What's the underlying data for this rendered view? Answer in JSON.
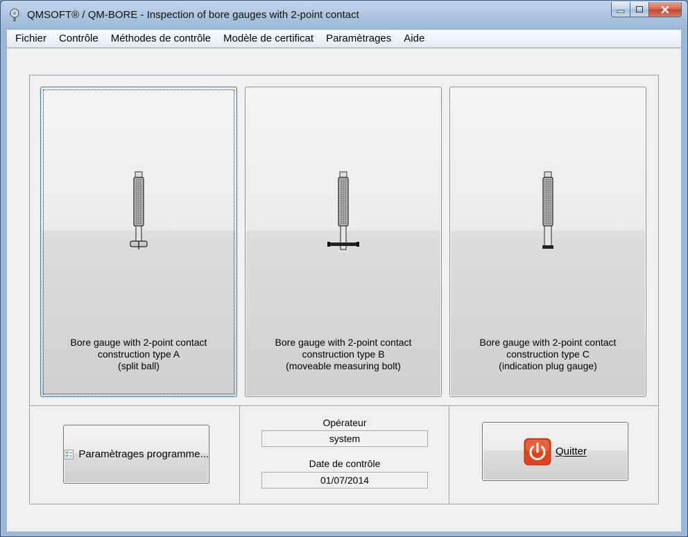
{
  "window": {
    "title": "QMSOFT® / QM-BORE - Inspection of bore gauges with 2-point contact"
  },
  "menu": [
    "Fichier",
    "Contrôle",
    "Méthodes de contrôle",
    "Modèle de certificat",
    "Paramètrages",
    "Aide"
  ],
  "cards": [
    {
      "lines": [
        "Bore gauge with 2-point contact",
        "construction type A",
        "(split ball)"
      ],
      "icon": "bore-gauge-split-ball-icon"
    },
    {
      "lines": [
        "Bore gauge with 2-point contact",
        "construction type B",
        "(moveable measuring bolt)"
      ],
      "icon": "bore-gauge-measuring-bolt-icon"
    },
    {
      "lines": [
        "Bore gauge with 2-point contact",
        "construction type C",
        "(indication plug gauge)"
      ],
      "icon": "bore-gauge-plug-icon"
    }
  ],
  "settings_button": {
    "label": "Paramètrages programme..."
  },
  "operator": {
    "label": "Opérateur",
    "value": "system"
  },
  "date": {
    "label": "Date de contrôle",
    "value": "01/07/2014"
  },
  "quit_button": {
    "label": "Quitter"
  },
  "colors": {
    "focus": "#3c7fb1",
    "quit_icon": "#e0441d",
    "titlebar": "#9bb8d7"
  }
}
